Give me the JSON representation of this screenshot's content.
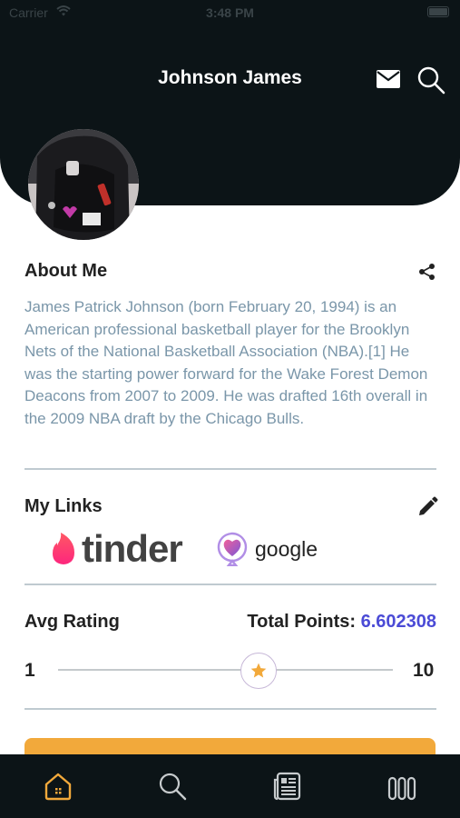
{
  "status_bar": {
    "carrier": "Carrier",
    "time": "3:48 PM"
  },
  "header": {
    "title": "Johnson James"
  },
  "about": {
    "title": "About Me",
    "text": "James Patrick Johnson (born February 20, 1994) is an American professional basketball player for the Brooklyn Nets of the National Basketball Association (NBA).[1] He was the starting power forward for the Wake Forest Demon Deacons from 2007 to 2009. He was drafted 16th overall in the 2009 NBA draft by the Chicago Bulls."
  },
  "links": {
    "title": "My Links",
    "items": [
      {
        "label": "tinder",
        "icon": "tinder-flame-icon"
      },
      {
        "label": "google",
        "icon": "heart-pin-icon"
      }
    ]
  },
  "rating": {
    "title": "Avg Rating",
    "total_points_label": "Total Points:",
    "total_points_value": "6.602308",
    "slider_min": "1",
    "slider_max": "10",
    "slider_position_fraction": 0.6
  },
  "colors": {
    "header_bg": "#0c1417",
    "accent_orange": "#f2a93b",
    "points_blue": "#4b4bd6",
    "about_text": "#7a96a9"
  },
  "tabbar": {
    "items": [
      {
        "icon": "home-icon",
        "active": true
      },
      {
        "icon": "search-icon",
        "active": false
      },
      {
        "icon": "news-icon",
        "active": false
      },
      {
        "icon": "stats-icon",
        "active": false
      }
    ]
  }
}
